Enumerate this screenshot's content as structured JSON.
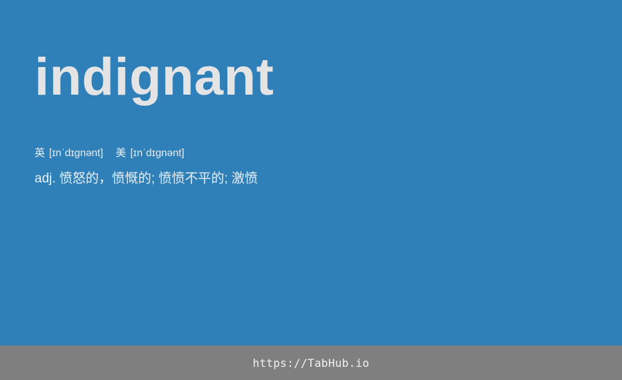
{
  "entry": {
    "word": "indignant",
    "phonetics": {
      "uk_label": "英",
      "uk_ipa": "[ɪnˈdɪɡnənt]",
      "us_label": "美",
      "us_ipa": "[ɪnˈdɪɡnənt]"
    },
    "definition": "adj. 愤怒的，愤慨的; 愤愤不平的; 激愤"
  },
  "footer": {
    "url": "https://TabHub.io"
  },
  "colors": {
    "background": "#2f80b8",
    "footer_background": "#7f7f7f",
    "word_text": "#e4e4e4"
  }
}
